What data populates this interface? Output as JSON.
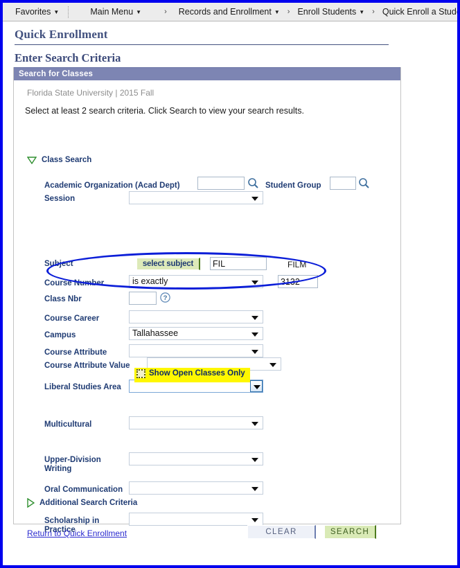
{
  "navbar": {
    "favorites": "Favorites",
    "main_menu": "Main Menu",
    "crumb1": "Records and Enrollment",
    "crumb2": "Enroll Students",
    "crumb3": "Quick Enroll a Student",
    "caret": "▼",
    "arrow": "›"
  },
  "page": {
    "title": "Quick Enrollment",
    "section_title": "Enter Search Criteria"
  },
  "groupbox": {
    "header": "Search for Classes",
    "context": "Florida State University | 2015 Fall",
    "instructions": "Select at least 2 search criteria. Click Search to view your search results."
  },
  "class_search": {
    "header": "Class Search",
    "acad_org": {
      "label": "Academic Organization (Acad Dept)",
      "value": "",
      "lookup_icon": "magnifier-icon"
    },
    "student_group": {
      "label": "Student Group",
      "value": "",
      "lookup_icon": "magnifier-icon"
    },
    "session": {
      "label": "Session",
      "value": ""
    },
    "subject": {
      "label": "Subject",
      "button_label": "select subject",
      "value": "FIL",
      "description": "FILM"
    },
    "course_number": {
      "label": "Course Number",
      "operator": "is exactly",
      "value": "3132"
    },
    "class_nbr": {
      "label": "Class Nbr",
      "value": "",
      "help_icon": "question-mark-icon"
    },
    "course_career": {
      "label": "Course Career",
      "value": ""
    },
    "campus": {
      "label": "Campus",
      "value": "Tallahassee"
    },
    "course_attribute": {
      "label": "Course Attribute",
      "value": ""
    },
    "course_attribute_value": {
      "label": "Course Attribute Value",
      "value": ""
    },
    "show_open_classes": {
      "label": "Show Open Classes Only",
      "checked": false
    },
    "liberal_studies_area": {
      "label": "Liberal Studies Area",
      "value": ""
    },
    "multicultural": {
      "label": "Multicultural",
      "value": ""
    },
    "upper_division_writing": {
      "label": "Upper-Division Writing",
      "label_line1": "Upper-Division",
      "label_line2": "Writing",
      "value": ""
    },
    "oral_communication": {
      "label": "Oral Communication",
      "value": ""
    },
    "scholarship_in_practice": {
      "label": "Scholarship in Practice",
      "label_line1": "Scholarship in",
      "label_line2": "Practice",
      "value": ""
    }
  },
  "additional_criteria": {
    "header": "Additional Search Criteria"
  },
  "footer": {
    "return_link": "Return to Quick Enrollment",
    "clear_button": "CLEAR",
    "search_button": "SEARCH"
  },
  "annotations": {
    "oval_highlight_target": "subject-and-course-number",
    "yellow_highlight_target": "show-open-classes-only"
  },
  "colors": {
    "accent_blue": "#7d85b3",
    "label_blue": "#1f3b73",
    "annotation_blue": "#0b1ed8",
    "highlight_yellow": "#fff700",
    "button_green": "#d9eab6",
    "frame_blue": "#0000ee"
  }
}
